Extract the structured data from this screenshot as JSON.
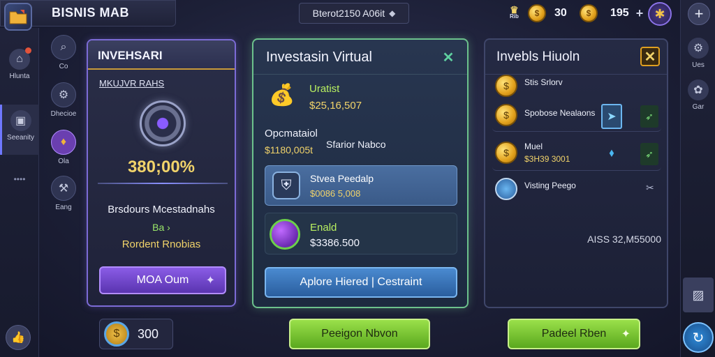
{
  "header": {
    "title": "BISNIS MAB",
    "search_text": "Bterot2150 A06it",
    "res1_value": "30",
    "res2_value": "195",
    "res0_label": "Rib"
  },
  "left_sidebar": {
    "items": [
      {
        "label": "Hlunta",
        "icon": "home-icon"
      },
      {
        "label": "Seeanity",
        "icon": "chest-icon"
      }
    ],
    "more": "••••"
  },
  "second_column": {
    "items": [
      {
        "label": "Co",
        "icon": "search-icon"
      },
      {
        "label": "Dhecioe",
        "icon": "gear-icon"
      },
      {
        "label": "Ola",
        "icon": "potion-icon"
      },
      {
        "label": "Eang",
        "icon": "hammer-icon"
      }
    ]
  },
  "right_sidebar": {
    "items": [
      {
        "label": "Ues",
        "icon": "gear-icon"
      },
      {
        "label": "Gar",
        "icon": "settings-icon"
      }
    ]
  },
  "panel_a": {
    "title": "INVEHSARI",
    "subtitle": "MKUJVR RAHS",
    "percent": "380;00%",
    "line1": "Brsdours Mcestadnahs",
    "line2": "Ba ›",
    "line3": "Rordent Rnobias",
    "button": "MOA Oum"
  },
  "panel_b": {
    "title": "Investasin Virtual",
    "item1_name": "Uratist",
    "item1_value": "$25,16,507",
    "mid_label": "Opcmataiol",
    "mid_value": "$1180,005t",
    "mid_right": "Sfarior Nabco",
    "item2_name": "Stvea Peedalp",
    "item2_value": "$0086 5,008",
    "item3_name": "Enald",
    "item3_value": "$3386.500",
    "button": "Aplore Hiered | Cestraint"
  },
  "panel_c": {
    "title": "Invebls Hiuoln",
    "rows": [
      {
        "name": "Stis Srlorv",
        "value": ""
      },
      {
        "name": "Spobose Nealaons",
        "value": ""
      },
      {
        "name": "Muel",
        "value": "$3H39 3001"
      },
      {
        "name": "Visting Peego",
        "value": ""
      }
    ],
    "total": "AISS 32,M55000"
  },
  "bottom": {
    "coins": "300",
    "button_center": "Peeigon Nbvon",
    "button_right": "Padeel Rben"
  },
  "colors": {
    "accent_purple": "#7c6bd6",
    "accent_green": "#6cc28c",
    "gold": "#f1d36a",
    "button_green": "#7ccf2e"
  }
}
